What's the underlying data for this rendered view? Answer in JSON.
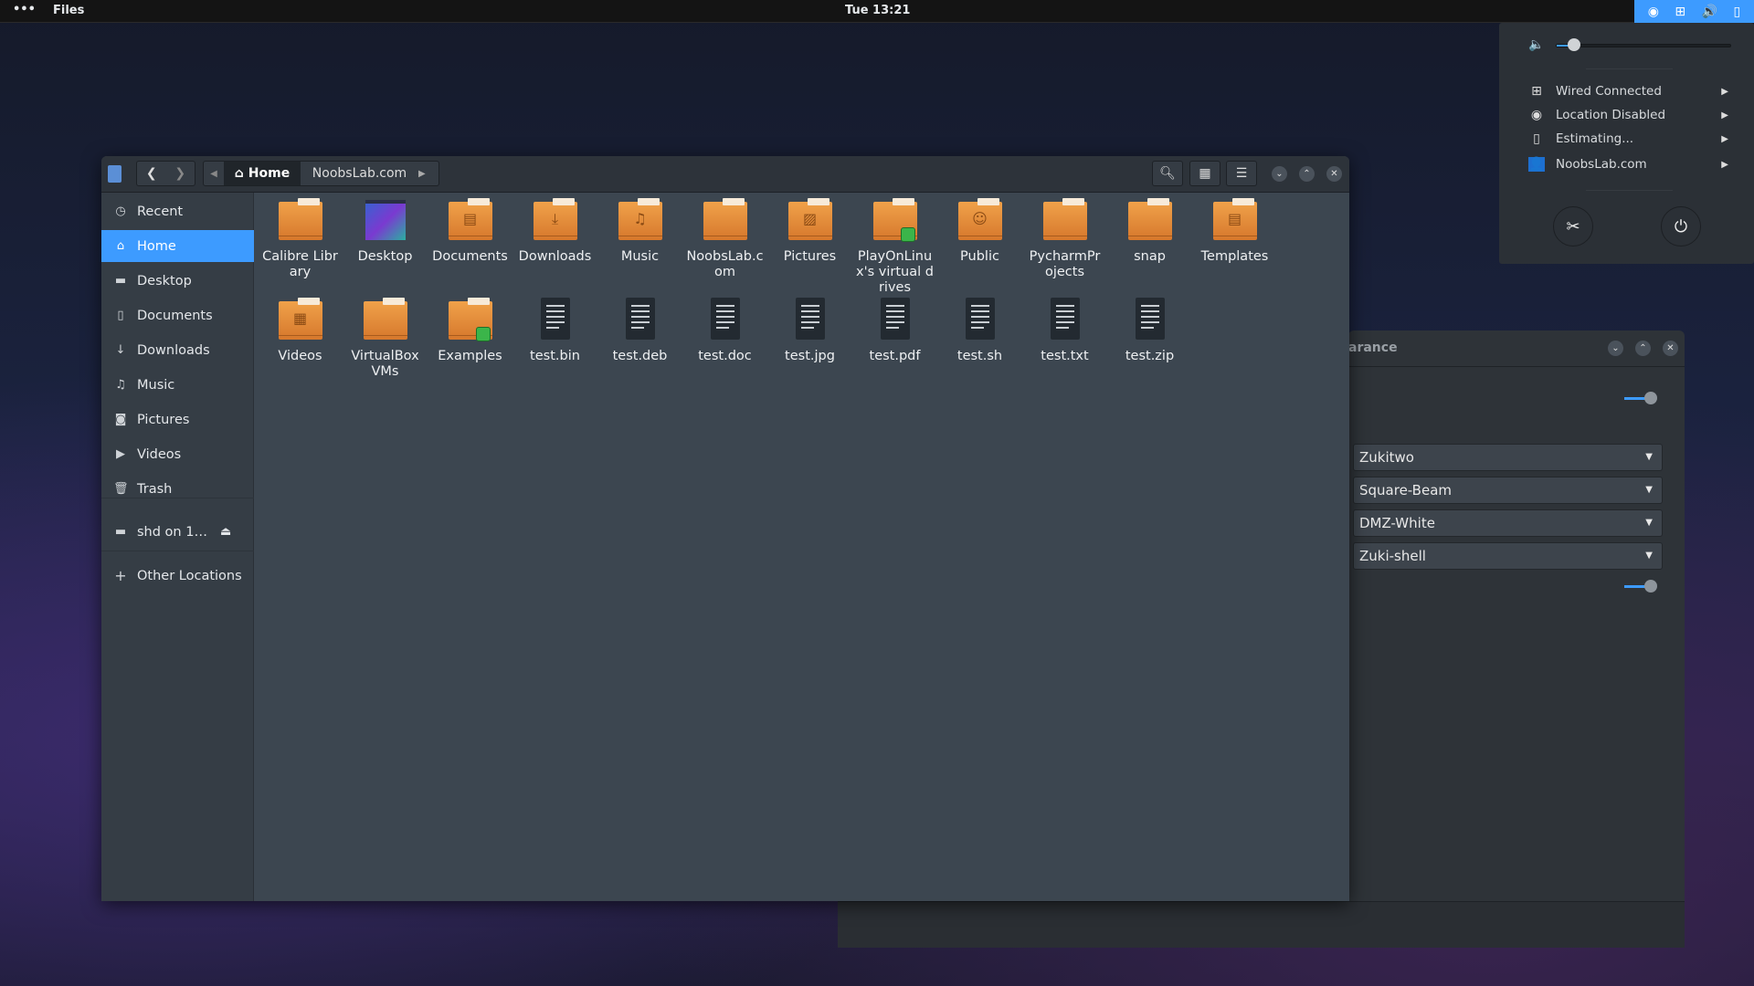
{
  "topbar": {
    "activities": "•••",
    "app": "Files",
    "clock": "Tue 13:21",
    "tray_icons": [
      "location-icon",
      "network-wired-icon",
      "volume-icon",
      "battery-icon"
    ]
  },
  "popup": {
    "volume_percent": 10,
    "items": [
      {
        "icon": "network-wired-icon",
        "glyph": "⊞",
        "label": "Wired Connected"
      },
      {
        "icon": "location-icon",
        "glyph": "◉",
        "label": "Location Disabled"
      },
      {
        "icon": "battery-icon",
        "glyph": "▯",
        "label": "Estimating..."
      },
      {
        "icon": "user-icon",
        "glyph": "👤",
        "label": "NoobsLab.com"
      }
    ],
    "settings_icon": "settings-icon",
    "power_icon": "power-icon"
  },
  "appearance": {
    "title_fragment": "arance",
    "dropdowns": [
      "Zukitwo",
      "Square-Beam",
      "DMZ-White",
      "Zuki-shell"
    ],
    "switch_1": true,
    "switch_2": true
  },
  "files": {
    "path": [
      "Home",
      "NoobsLab.com"
    ],
    "sidebar": [
      {
        "icon": "clock-icon",
        "glyph": "◷",
        "label": "Recent"
      },
      {
        "icon": "home-icon",
        "glyph": "⌂",
        "label": "Home",
        "selected": true
      },
      {
        "icon": "folder-icon",
        "glyph": "▬",
        "label": "Desktop"
      },
      {
        "icon": "document-icon",
        "glyph": "▯",
        "label": "Documents"
      },
      {
        "icon": "download-icon",
        "glyph": "↓",
        "label": "Downloads"
      },
      {
        "icon": "music-icon",
        "glyph": "♫",
        "label": "Music"
      },
      {
        "icon": "camera-icon",
        "glyph": "◙",
        "label": "Pictures"
      },
      {
        "icon": "video-icon",
        "glyph": "▶",
        "label": "Videos"
      },
      {
        "icon": "trash-icon",
        "glyph": "🗑",
        "label": "Trash"
      }
    ],
    "network_mount": {
      "label": "shd on 1…",
      "icon": "network-folder-icon",
      "eject": "eject-icon"
    },
    "other_locations": "Other Locations",
    "items": [
      {
        "label": "Calibre Library",
        "type": "folder"
      },
      {
        "label": "Desktop",
        "type": "desktop"
      },
      {
        "label": "Documents",
        "type": "folder",
        "glyph": "▤"
      },
      {
        "label": "Downloads",
        "type": "folder",
        "glyph": "⤓"
      },
      {
        "label": "Music",
        "type": "folder",
        "glyph": "♫"
      },
      {
        "label": "NoobsLab.com",
        "type": "folder"
      },
      {
        "label": "Pictures",
        "type": "folder",
        "glyph": "▨"
      },
      {
        "label": "PlayOnLinux's virtual drives",
        "type": "folder",
        "emblem": true
      },
      {
        "label": "Public",
        "type": "folder",
        "glyph": "☺"
      },
      {
        "label": "PycharmProjects",
        "type": "folder"
      },
      {
        "label": "snap",
        "type": "folder"
      },
      {
        "label": "Templates",
        "type": "folder",
        "glyph": "▤"
      },
      {
        "label": "Videos",
        "type": "folder",
        "glyph": "▦"
      },
      {
        "label": "VirtualBox VMs",
        "type": "folder"
      },
      {
        "label": "Examples",
        "type": "folder",
        "emblem": true
      },
      {
        "label": "test.bin",
        "type": "file"
      },
      {
        "label": "test.deb",
        "type": "file"
      },
      {
        "label": "test.doc",
        "type": "file"
      },
      {
        "label": "test.jpg",
        "type": "file"
      },
      {
        "label": "test.pdf",
        "type": "file"
      },
      {
        "label": "test.sh",
        "type": "file"
      },
      {
        "label": "test.txt",
        "type": "file"
      },
      {
        "label": "test.zip",
        "type": "file"
      }
    ]
  },
  "colors": {
    "accent": "#3d9bff",
    "folder": "#e8913e"
  }
}
